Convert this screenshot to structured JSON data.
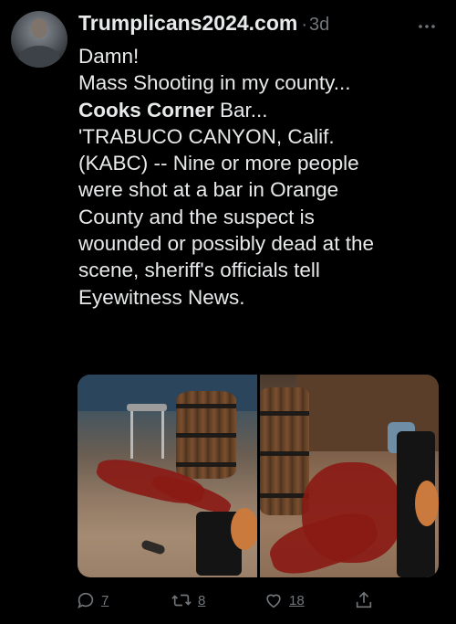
{
  "tweet": {
    "handle": "Trumplicans2024.com",
    "separator": "·",
    "time": "3d",
    "more_icon": "more-icon",
    "text_lines": [
      "Damn!",
      "Mass Shooting in my county...",
      "",
      "'TRABUCO CANYON, Calif.",
      "(KABC) -- Nine or more people",
      "were  shot at a bar in Orange",
      "County and the suspect is",
      "wounded or possibly  dead at the",
      "scene, sheriff's officials tell",
      "Eyewitness News."
    ],
    "line3_bold": "Cooks Corner",
    "line3_rest": " Bar..."
  },
  "media": {
    "images": [
      "crime-scene-photo-left",
      "crime-scene-photo-right"
    ]
  },
  "actions": {
    "reply_count": "7",
    "retweet_count": "8",
    "like_count": "18",
    "share_icon": "share-icon"
  },
  "colors": {
    "background": "#000000",
    "text": "#e7e9ea",
    "muted": "#71767b"
  }
}
